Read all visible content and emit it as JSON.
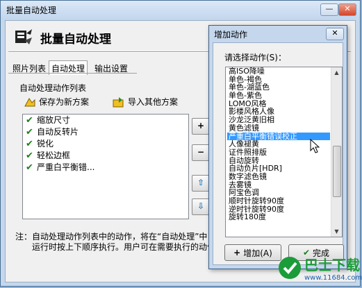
{
  "window": {
    "title": "批量自动处理",
    "minimize": "0",
    "close": "r"
  },
  "header": {
    "title": "批量自动处理"
  },
  "tabs": [
    "照片列表",
    "自动处理",
    "输出设置"
  ],
  "group": {
    "label": "自动处理动作列表"
  },
  "toolbar": {
    "save_label": "保存为新方案",
    "import_label": "导入其他方案"
  },
  "actions": [
    {
      "label": "缩放尺寸"
    },
    {
      "label": "自动反转片"
    },
    {
      "label": "锐化"
    },
    {
      "label": "轻松边框"
    },
    {
      "label": "严重白平衡错..."
    }
  ],
  "side_buttons": {
    "add": "+",
    "remove": "−",
    "up": "⇧",
    "down": "⇩"
  },
  "note": {
    "line1": "注：自动处理动作列表中的动作，将在“自动处理”中",
    "line2": "运行时按上下顺序执行。用户可在需要执行的动作"
  },
  "dialog": {
    "title": "增加动作",
    "close": "✕",
    "prompt": "请选择动作(S)：",
    "items": [
      "高ISO降噪",
      "单色-褐色",
      "单色-湖蓝色",
      "单色-紫色",
      "LOMO风格",
      "影楼风格人像",
      "沙龙泛黄旧相",
      "黄色滤镜",
      "严重白平衡错误校正",
      "人像褪黄",
      "证件照排版",
      "自动旋转",
      "自动负片[HDR]",
      "数字滤色镜",
      "去雾镜",
      "阿宝色调",
      "顺时针旋转90度",
      "逆时针旋转90度",
      "旋转180度"
    ],
    "selected_index": 8,
    "add_label": "增加(A)",
    "done_label": "完成"
  },
  "watermark": {
    "brand": "巴士下载",
    "url": "www.11684.com"
  },
  "colors": {
    "selection": "#3399ff",
    "check": "#1e7d1e"
  }
}
